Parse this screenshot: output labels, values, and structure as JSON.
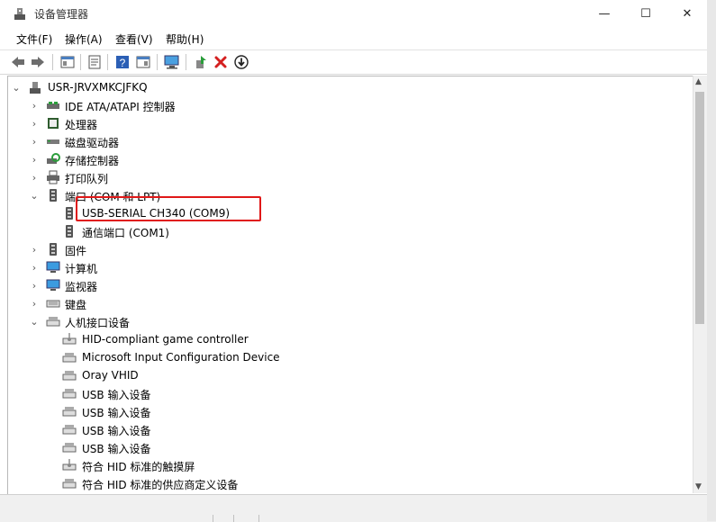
{
  "window": {
    "title": "设备管理器",
    "controls": {
      "minimize": "—",
      "maximize": "☐",
      "close": "✕"
    }
  },
  "menu": [
    "文件(F)",
    "操作(A)",
    "查看(V)",
    "帮助(H)"
  ],
  "toolbar": {
    "icons": [
      "back-icon",
      "forward-icon",
      "show-hide-console-tree-icon",
      "properties-icon",
      "help-icon",
      "action-pane-icon",
      "scan-hardware-icon",
      "update-driver-icon",
      "uninstall-icon",
      "disable-icon"
    ]
  },
  "colors": {
    "highlight": "#e01818",
    "uninstall": "#d42020"
  },
  "tree": {
    "root": "USR-JRVXMKCJFKQ",
    "nodes": [
      {
        "label": "IDE ATA/ATAPI 控制器",
        "icon": "ide-controller-icon",
        "expanded": false
      },
      {
        "label": "处理器",
        "icon": "processor-icon",
        "expanded": false
      },
      {
        "label": "磁盘驱动器",
        "icon": "disk-drive-icon",
        "expanded": false
      },
      {
        "label": "存储控制器",
        "icon": "storage-controller-icon",
        "expanded": false
      },
      {
        "label": "打印队列",
        "icon": "print-queue-icon",
        "expanded": false
      },
      {
        "label": "端口 (COM 和 LPT)",
        "icon": "port-icon",
        "expanded": true,
        "children": [
          {
            "label": "USB-SERIAL CH340 (COM9)",
            "icon": "port-device-icon"
          },
          {
            "label": "通信端口 (COM1)",
            "icon": "port-device-icon"
          }
        ]
      },
      {
        "label": "固件",
        "icon": "firmware-icon",
        "expanded": false
      },
      {
        "label": "计算机",
        "icon": "computer-icon",
        "expanded": false
      },
      {
        "label": "监视器",
        "icon": "monitor-icon",
        "expanded": false
      },
      {
        "label": "键盘",
        "icon": "keyboard-icon",
        "expanded": false
      },
      {
        "label": "人机接口设备",
        "icon": "hid-icon",
        "expanded": true,
        "children": [
          {
            "label": "HID-compliant game controller",
            "icon": "hid-device-icon"
          },
          {
            "label": "Microsoft Input Configuration Device",
            "icon": "hid-device-icon"
          },
          {
            "label": "Oray VHID",
            "icon": "hid-device-icon"
          },
          {
            "label": "USB 输入设备",
            "icon": "hid-device-icon"
          },
          {
            "label": "USB 输入设备",
            "icon": "hid-device-icon"
          },
          {
            "label": "USB 输入设备",
            "icon": "hid-device-icon"
          },
          {
            "label": "USB 输入设备",
            "icon": "hid-device-icon"
          },
          {
            "label": "符合 HID 标准的触摸屏",
            "icon": "hid-device-icon"
          },
          {
            "label": "符合 HID 标准的供应商定义设备",
            "icon": "hid-device-icon"
          }
        ]
      }
    ]
  }
}
